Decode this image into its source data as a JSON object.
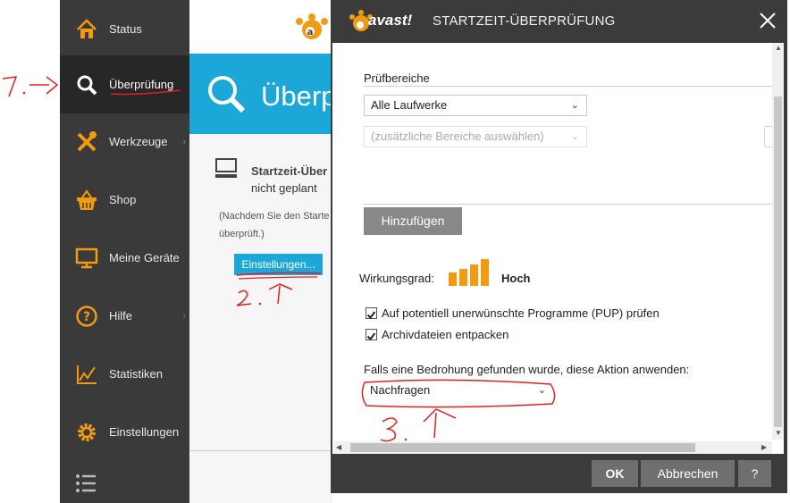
{
  "annotations": {
    "step1": "1.->",
    "step2": "2.↑",
    "step3": "3.↑"
  },
  "sidebar": {
    "items": [
      {
        "label": "Status",
        "icon": "home-icon"
      },
      {
        "label": "Überprüfung",
        "icon": "search-icon"
      },
      {
        "label": "Werkzeuge",
        "icon": "tools-icon"
      },
      {
        "label": "Shop",
        "icon": "basket-icon"
      },
      {
        "label": "Meine Geräte",
        "icon": "monitor-icon"
      },
      {
        "label": "Hilfe",
        "icon": "help-icon"
      },
      {
        "label": "Statistiken",
        "icon": "chart-icon"
      },
      {
        "label": "Einstellungen",
        "icon": "gear-icon"
      }
    ],
    "active_index": 1
  },
  "main": {
    "banner_title": "Überpr",
    "card_title": "Startzeit-Über",
    "card_status": "nicht geplant",
    "card_note_1": "(Nachdem Sie den Starte",
    "card_note_2": "überprüft.)",
    "settings_button": "Einstellungen..."
  },
  "dialog": {
    "brand": "avast!",
    "title": "STARTZEIT-ÜBERPRÜFUNG",
    "scan_areas_label": "Prüfbereiche",
    "drive_select": "Alle Laufwerke",
    "extra_areas_placeholder": "(zusätzliche Bereiche auswählen)",
    "add_button": "Hinzufügen",
    "efficiency_label": "Wirkungsgrad:",
    "efficiency_value": "Hoch",
    "efficiency_level": "4 of 4",
    "checkbox_pup": "Auf potentiell unerwünschte Programme (PUP) prüfen",
    "checkbox_pup_checked": true,
    "checkbox_archive": "Archivdateien entpacken",
    "checkbox_archive_checked": true,
    "threat_action_label": "Falls eine Bedrohung gefunden wurde, diese Aktion anwenden:",
    "threat_action_select": "Nachfragen",
    "ok_button": "OK",
    "cancel_button": "Abbrechen",
    "help_button": "?"
  },
  "colors": {
    "accent_orange": "#f29b10",
    "banner_blue": "#1ba8d8",
    "sidebar_bg": "#3a3a3a",
    "annotation_red": "#e02020"
  }
}
